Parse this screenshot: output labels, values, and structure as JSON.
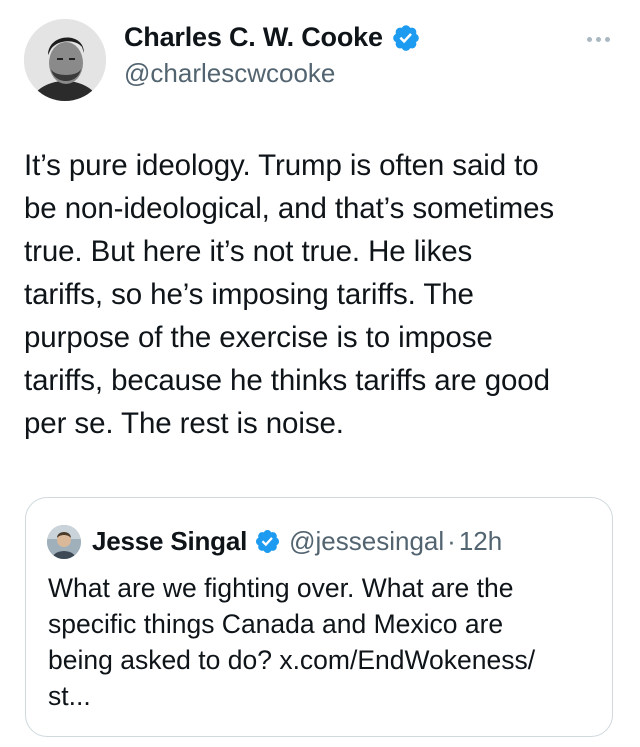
{
  "tweet": {
    "author": {
      "name": "Charles C. W. Cooke",
      "handle": "@charlescwcooke",
      "avatar_icon": "avatar-photo-icon",
      "verified_icon": "verified-badge-icon"
    },
    "more_icon": "more-options-icon",
    "text": "It’s pure ideology. Trump is often said to\nbe non-ideological, and that’s sometimes\ntrue. But here it’s not true. He likes\ntariffs, so he’s imposing tariffs. The\npurpose of the exercise is to impose\ntariffs, because he thinks tariffs are good\nper se. The rest is noise."
  },
  "quote": {
    "author": {
      "name": "Jesse Singal",
      "handle": "@jessesingal",
      "separator": "·",
      "time": "12h"
    },
    "text": "What are we fighting over. What are the\nspecific things Canada and Mexico are\nbeing asked to do? x.com/EndWokeness/\nst..."
  },
  "colors": {
    "verified_blue": "#1d9bf0",
    "secondary_text": "#536471",
    "border": "#cfd9de",
    "primary_text": "#0f1419"
  }
}
